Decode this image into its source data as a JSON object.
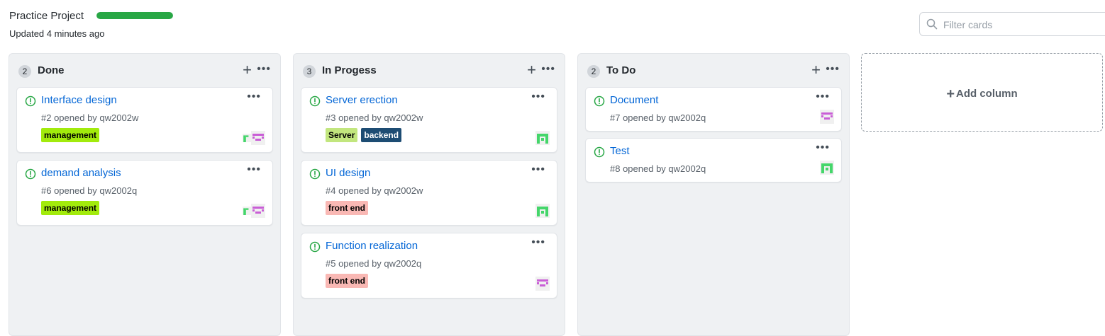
{
  "header": {
    "title": "Practice Project",
    "progress_percent": 100,
    "progress_color": "#28a745",
    "updated": "Updated 4 minutes ago"
  },
  "filter": {
    "placeholder": "Filter cards",
    "value": "",
    "icon": "search-icon"
  },
  "colors": {
    "column_bg": "#eff1f3",
    "link": "#0366d6",
    "open_issue": "#28a745",
    "label_management": "#a2eb0c",
    "label_server": "#c2e67e",
    "label_backend": "#1d4c73",
    "label_frontend": "#f9b8b4"
  },
  "columns": [
    {
      "count": "2",
      "title": "Done",
      "add_icon": "plus-icon",
      "more_icon": "kebab-icon",
      "cards": [
        {
          "title": "Interface design",
          "meta": "#2 opened by qw2002w",
          "more": "···",
          "labels": [
            {
              "text": "management",
              "bg": "#a2eb0c",
              "fg": "#000000"
            }
          ],
          "avatars": [
            "green",
            "purple"
          ]
        },
        {
          "title": "demand analysis",
          "meta": "#6 opened by qw2002q",
          "more": "···",
          "labels": [
            {
              "text": "management",
              "bg": "#a2eb0c",
              "fg": "#000000"
            }
          ],
          "avatars": [
            "green",
            "purple"
          ]
        }
      ]
    },
    {
      "count": "3",
      "title": "In Progess",
      "add_icon": "plus-icon",
      "more_icon": "kebab-icon",
      "cards": [
        {
          "title": "Server erection",
          "meta": "#3 opened by qw2002w",
          "more": "···",
          "labels": [
            {
              "text": "Server",
              "bg": "#c2e67e",
              "fg": "#000000"
            },
            {
              "text": "backend",
              "bg": "#1d4c73",
              "fg": "#ffffff"
            }
          ],
          "avatars": [
            "green"
          ]
        },
        {
          "title": "UI design",
          "meta": "#4 opened by qw2002w",
          "more": "···",
          "labels": [
            {
              "text": "front end",
              "bg": "#f9b8b4",
              "fg": "#000000"
            }
          ],
          "avatars": [
            "green"
          ]
        },
        {
          "title": "Function realization",
          "meta": "#5 opened by qw2002q",
          "more": "···",
          "labels": [
            {
              "text": "front end",
              "bg": "#f9b8b4",
              "fg": "#000000"
            }
          ],
          "avatars": [
            "purple"
          ]
        }
      ]
    },
    {
      "count": "2",
      "title": "To Do",
      "add_icon": "plus-icon",
      "more_icon": "kebab-icon",
      "cards": [
        {
          "title": "Document",
          "meta": "#7 opened by qw2002q",
          "more": "···",
          "labels": [],
          "avatars": [
            "purple"
          ]
        },
        {
          "title": "Test",
          "meta": "#8 opened by qw2002q",
          "more": "···",
          "labels": [],
          "avatars": [
            "green"
          ]
        }
      ]
    }
  ],
  "add_column": {
    "label": "Add column",
    "icon": "plus-icon"
  }
}
